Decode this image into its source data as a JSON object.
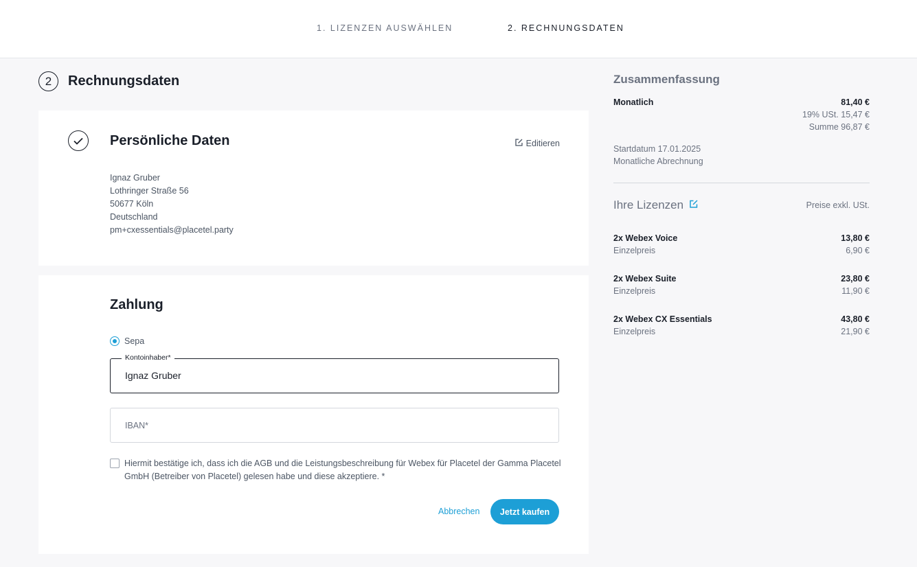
{
  "steps": {
    "step1": "1. LIZENZEN AUSWÄHLEN",
    "step2": "2. RECHNUNGSDATEN"
  },
  "section": {
    "number": "2",
    "title": "Rechnungsdaten"
  },
  "personal": {
    "title": "Persönliche Daten",
    "edit_label": "Editieren",
    "name": "Ignaz Gruber",
    "street": "Lothringer Straße 56",
    "city": "50677 Köln",
    "country": "Deutschland",
    "email": "pm+cxessentials@placetel.party"
  },
  "payment": {
    "title": "Zahlung",
    "method_label": "Sepa",
    "method_selected": true,
    "owner_label": "Kontoinhaber*",
    "owner_value": "Ignaz Gruber",
    "iban_placeholder": "IBAN*",
    "consent_text": "Hiermit bestätige ich, dass ich die AGB und die Leistungsbeschreibung für Webex für Placetel der Gamma Placetel GmbH (Betreiber von Placetel) gelesen habe und diese akzeptiere. *",
    "consent_checked": false,
    "cancel_label": "Abbrechen",
    "buy_label": "Jetzt kaufen"
  },
  "summary": {
    "title": "Zusammenfassung",
    "period_label": "Monatlich",
    "period_amount": "81,40 €",
    "vat_line": "19% USt. 15,47 €",
    "total_line": "Summe 96,87 €",
    "start_date": "Startdatum 17.01.2025",
    "billing": "Monatliche Abrechnung"
  },
  "licenses": {
    "title": "Ihre Lizenzen",
    "price_note": "Preise exkl. USt.",
    "unit_label": "Einzelpreis",
    "items": [
      {
        "name": "2x Webex Voice",
        "total": "13,80 €",
        "unit": "6,90 €"
      },
      {
        "name": "2x Webex Suite",
        "total": "23,80 €",
        "unit": "11,90 €"
      },
      {
        "name": "2x Webex CX Essentials",
        "total": "43,80 €",
        "unit": "21,90 €"
      }
    ]
  },
  "colors": {
    "accent": "#1d9fd6",
    "text": "#1a1f29",
    "muted": "#6b7280",
    "background": "#f7f7f9"
  },
  "icons": {
    "step_check": "checkmark-circle-icon",
    "edit": "edit-icon",
    "licenses_edit": "edit-icon"
  }
}
